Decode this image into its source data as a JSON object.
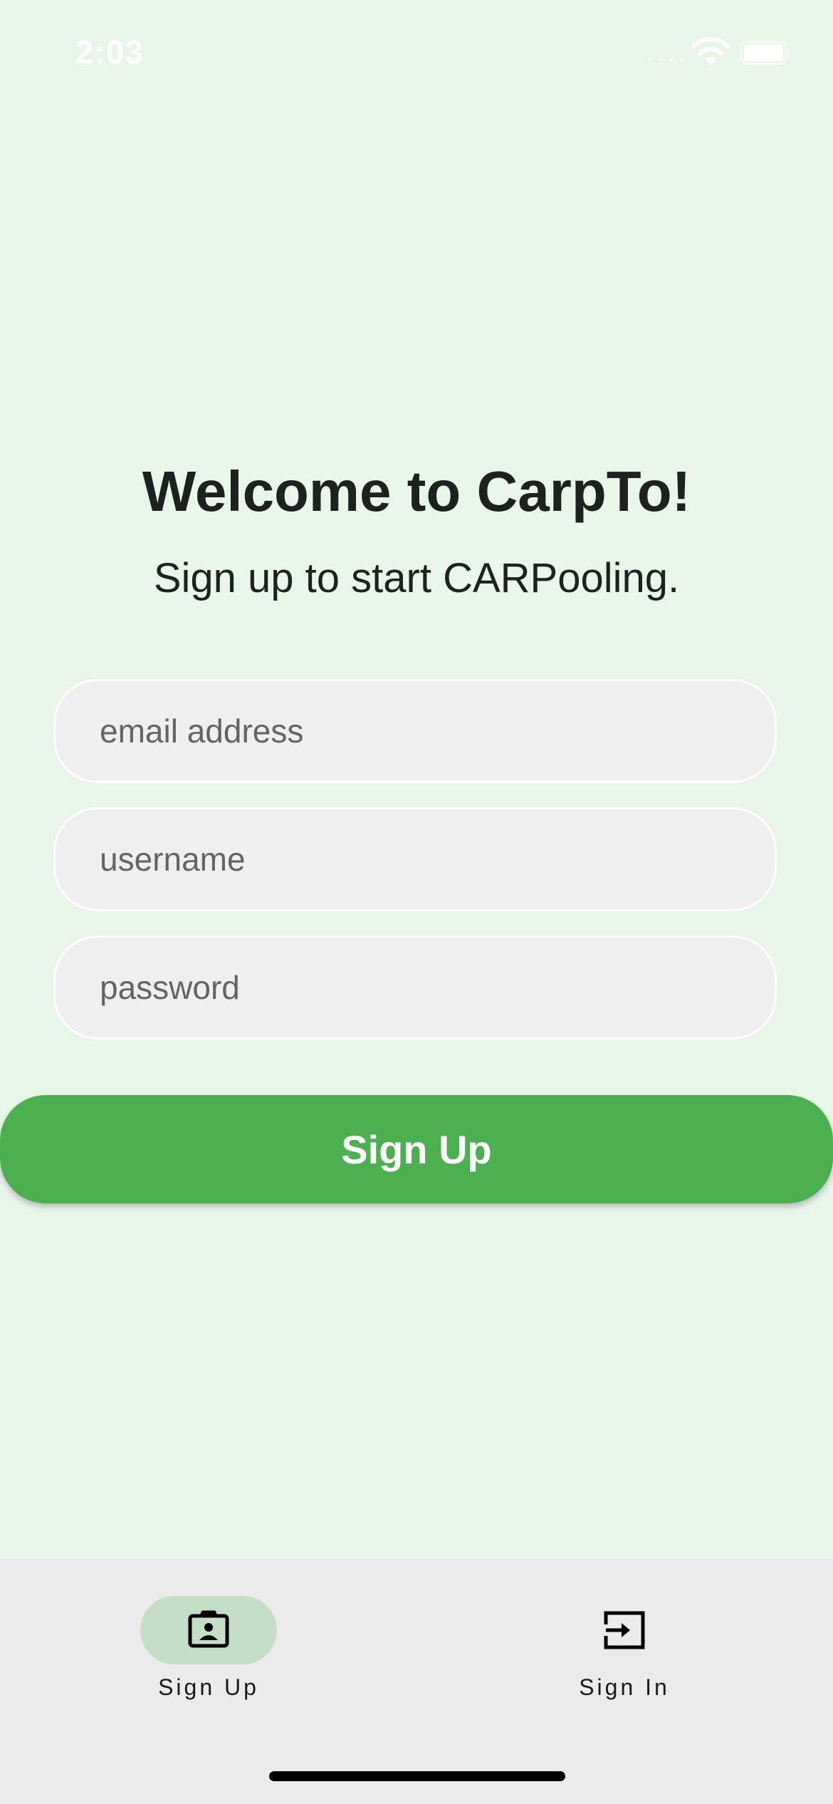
{
  "status_bar": {
    "time": "2:03"
  },
  "header": {
    "title": "Welcome to CarpTo!",
    "subtitle": "Sign up to start CARPooling."
  },
  "form": {
    "email": {
      "placeholder": "email address",
      "value": ""
    },
    "username": {
      "placeholder": "username",
      "value": ""
    },
    "password": {
      "placeholder": "password",
      "value": ""
    },
    "submit_label": "Sign Up"
  },
  "bottom_nav": {
    "items": [
      {
        "label": "Sign Up",
        "icon": "contact-badge-icon",
        "active": true
      },
      {
        "label": "Sign In",
        "icon": "login-icon",
        "active": false
      }
    ]
  },
  "colors": {
    "background": "#e8f5e9",
    "accent": "#4caf50",
    "active_nav_pill": "#c4dfc6",
    "nav_background": "#ebebeb",
    "field_background": "#efefef"
  }
}
